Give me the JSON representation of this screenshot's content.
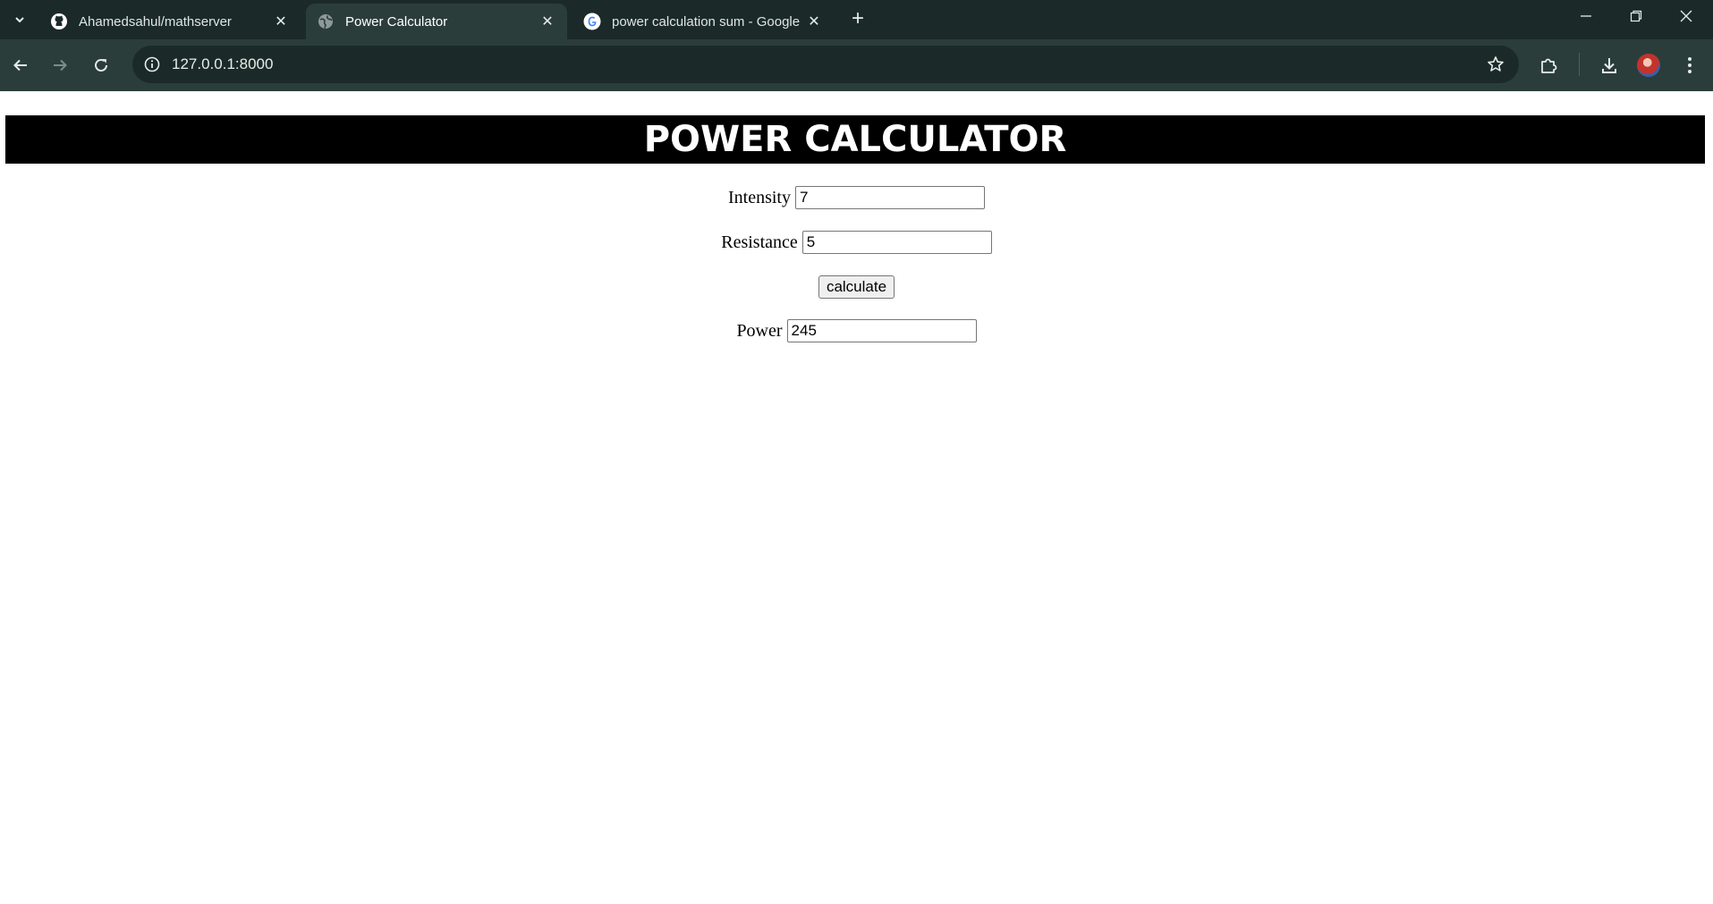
{
  "browser": {
    "tabs": [
      {
        "title": "Ahamedsahul/mathserver",
        "favicon": "github-icon",
        "active": false
      },
      {
        "title": "Power Calculator",
        "favicon": "globe-icon",
        "active": true
      },
      {
        "title": "power calculation sum - Google",
        "favicon": "google-icon",
        "active": false
      }
    ],
    "new_tab_label": "+",
    "url": "127.0.0.1:8000"
  },
  "page": {
    "heading": "POWER CALCULATOR",
    "fields": {
      "intensity": {
        "label": "Intensity",
        "value": "7"
      },
      "resistance": {
        "label": "Resistance",
        "value": "5"
      },
      "power": {
        "label": "Power",
        "value": "245"
      }
    },
    "calculate_label": "calculate"
  },
  "colors": {
    "tab_strip": "#1b2a28",
    "toolbar": "#2b3d3a",
    "banner_bg": "#000000",
    "banner_text": "#ffffff"
  }
}
